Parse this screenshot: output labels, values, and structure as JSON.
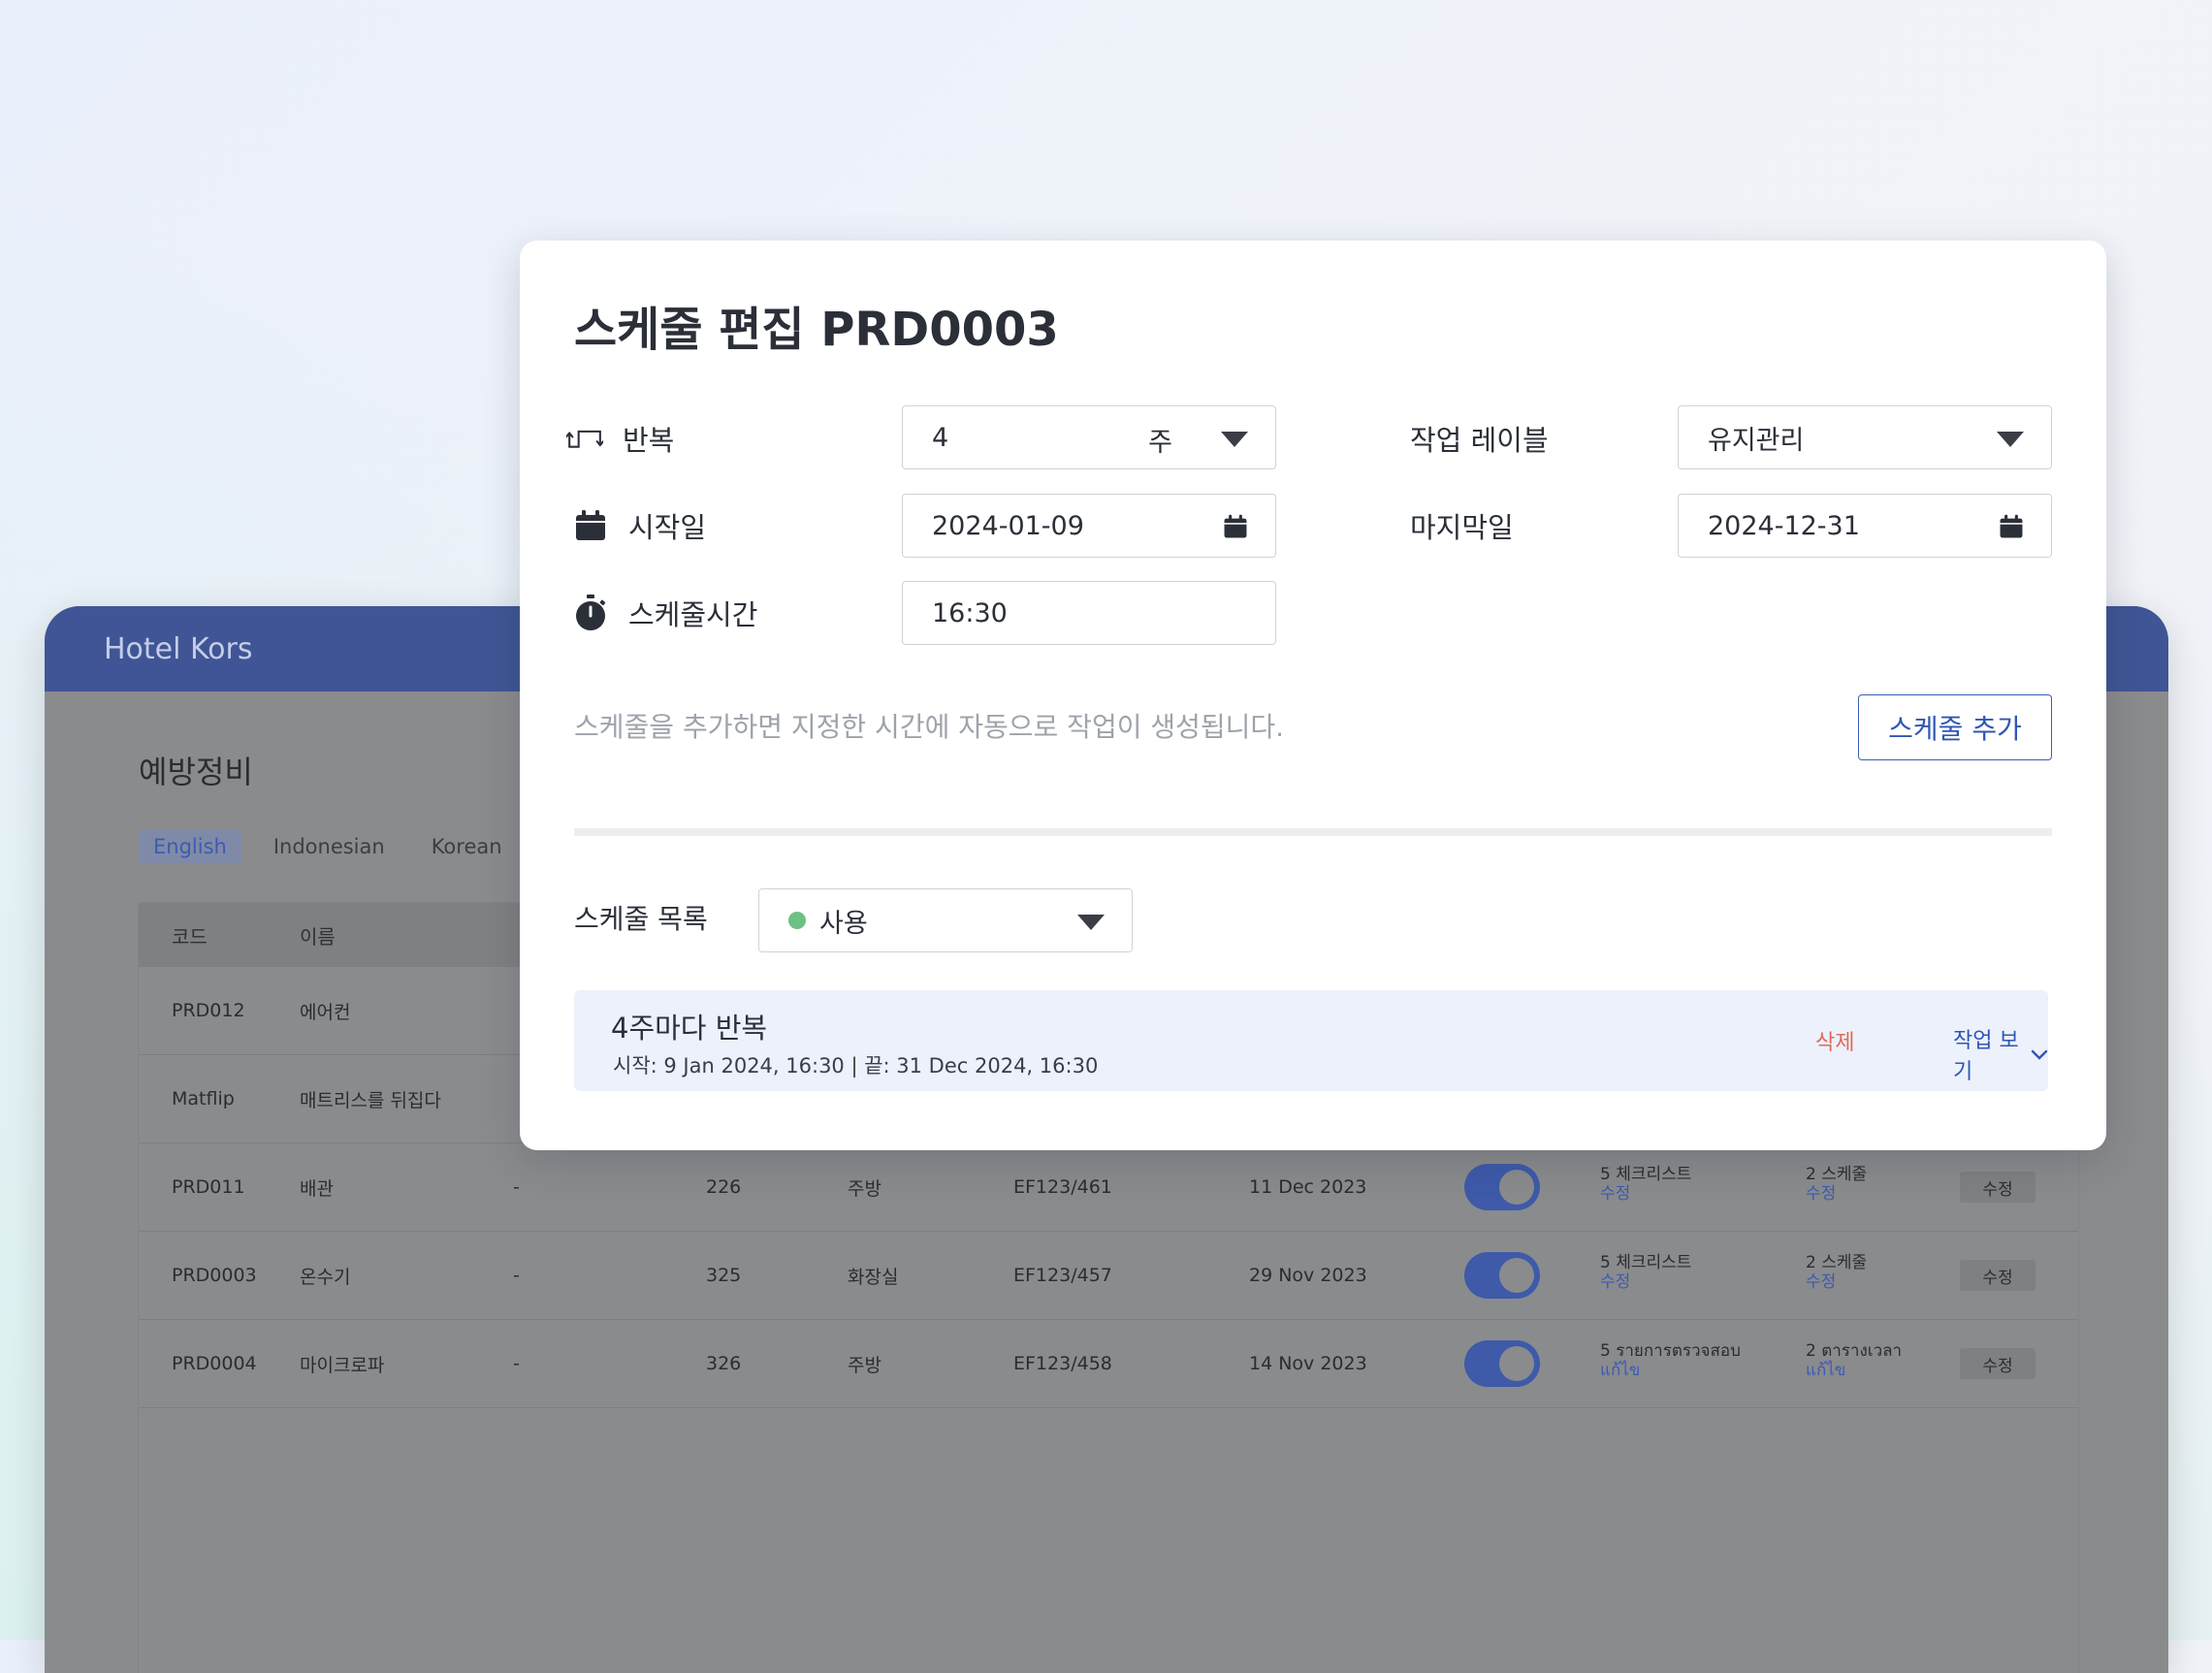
{
  "app": {
    "brand": "Hotel Kors",
    "page_title": "예방정비",
    "lang_tabs": [
      "English",
      "Indonesian",
      "Korean"
    ],
    "table": {
      "headers": [
        "코드",
        "이름"
      ],
      "rows": [
        {
          "code": "PRD012",
          "name": "에어컨",
          "dash": "",
          "num": "",
          "location": "",
          "ref": "",
          "date": ""
        },
        {
          "code": "Matflip",
          "name": "매트리스를 뒤집다",
          "dash": "",
          "num": "",
          "location": "",
          "ref": "",
          "date": ""
        },
        {
          "code": "PRD011",
          "name": "배관",
          "dash": "-",
          "num": "226",
          "location": "주방",
          "ref": "EF123/461",
          "date": "11 Dec 2023",
          "checklist": "5 체크리스트",
          "checklist_link": "수정",
          "schedule": "2 스케줄",
          "schedule_link": "수정",
          "edit": "수정"
        },
        {
          "code": "PRD0003",
          "name": "온수기",
          "dash": "-",
          "num": "325",
          "location": "화장실",
          "ref": "EF123/457",
          "date": "29 Nov 2023",
          "checklist": "5 체크리스트",
          "checklist_link": "수정",
          "schedule": "2 스케줄",
          "schedule_link": "수정",
          "edit": "수정"
        },
        {
          "code": "PRD0004",
          "name": "마이크로파",
          "dash": "-",
          "num": "326",
          "location": "주방",
          "ref": "EF123/458",
          "date": "14 Nov 2023",
          "checklist": "5 รายการตรวจสอบ",
          "checklist_link": "แก้ไข",
          "schedule": "2 ตารางเวลา",
          "schedule_link": "แก้ไข",
          "edit": "수정"
        }
      ]
    }
  },
  "modal": {
    "title": "스케줄 편집 PRD0003",
    "repeat": {
      "label": "반복",
      "value": "4",
      "unit": "주"
    },
    "job_label": {
      "label": "작업 레이블",
      "value": "유지관리"
    },
    "start_date": {
      "label": "시작일",
      "value": "2024-01-09"
    },
    "end_date": {
      "label": "마지막일",
      "value": "2024-12-31"
    },
    "schedule_time": {
      "label": "스케줄시간",
      "value": "16:30"
    },
    "hint": "스케줄을 추가하면 지정한 시간에 자동으로 작업이 생성됩니다.",
    "add_button": "스케줄 추가",
    "list_label": "스케줄 목록",
    "status_filter": "사용",
    "entry": {
      "title": "4주마다 반복",
      "subtitle": "시작: 9 Jan 2024, 16:30 | 끝: 31 Dec 2024, 16:30",
      "delete": "삭제",
      "view": "작업 보기"
    }
  },
  "icons": {
    "repeat": "repeat-icon",
    "calendar": "calendar-icon",
    "timer": "stopwatch-icon",
    "dropdown": "caret-down-icon",
    "chevron": "chevron-down-icon"
  },
  "colors": {
    "brand": "#3f5595",
    "accent": "#2f56b5",
    "danger": "#e06a55",
    "active_dot": "#6cc184"
  }
}
